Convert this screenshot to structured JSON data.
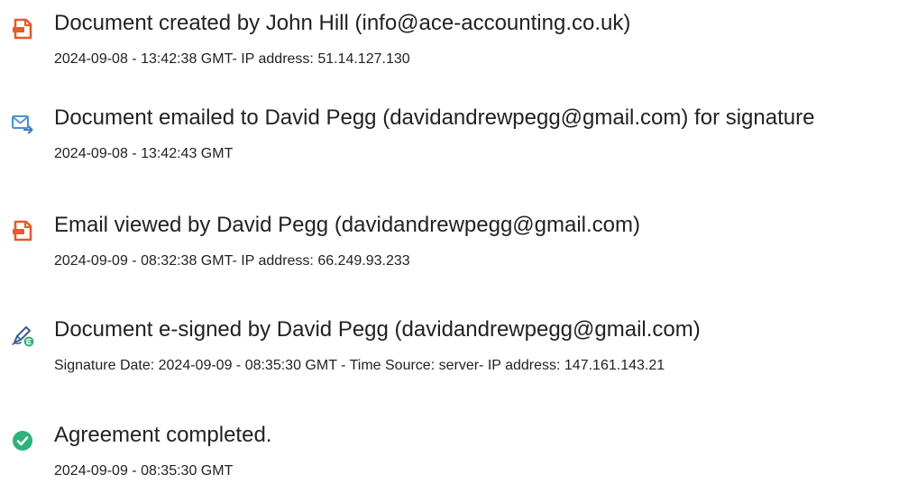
{
  "colors": {
    "document_icon": "#e35b2e",
    "email_icon": "#4a90d9",
    "sign_icon": "#3a5f8a",
    "sign_badge": "#3bb273",
    "complete_icon": "#2db37a"
  },
  "events": [
    {
      "icon": "document-icon",
      "title": "Document created by John Hill (info@ace-accounting.co.uk)",
      "detail": "2024-09-08 - 13:42:38 GMT- IP address: 51.14.127.130"
    },
    {
      "icon": "email-forward-icon",
      "title": "Document emailed to David Pegg (davidandrewpegg@gmail.com) for signature",
      "detail": "2024-09-08 - 13:42:43 GMT"
    },
    {
      "icon": "document-icon",
      "title": "Email viewed by David Pegg (davidandrewpegg@gmail.com)",
      "detail": "2024-09-09 - 08:32:38 GMT- IP address: 66.249.93.233"
    },
    {
      "icon": "e-sign-pen-icon",
      "title": "Document e-signed by David Pegg (davidandrewpegg@gmail.com)",
      "detail": "Signature Date: 2024-09-09 - 08:35:30 GMT - Time Source: server- IP address: 147.161.143.21"
    },
    {
      "icon": "checkmark-circle-icon",
      "title": "Agreement completed.",
      "detail": "2024-09-09 - 08:35:30 GMT"
    }
  ]
}
